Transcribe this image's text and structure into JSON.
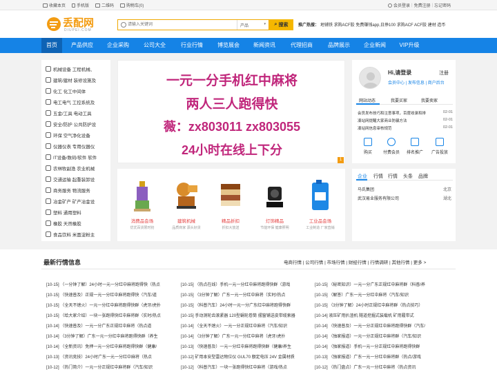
{
  "topbar": {
    "left": [
      {
        "icon": "star-icon",
        "label": "收藏本页"
      },
      {
        "icon": "mobile-icon",
        "label": "手机版"
      },
      {
        "icon": "qrcode-icon",
        "label": "二维码"
      },
      {
        "icon": "cart-icon",
        "label": "购物车(0)"
      }
    ],
    "right": {
      "user_icon": "user-icon",
      "login": "会员登录",
      "sep1": "|",
      "register": "免费注册",
      "sep2": "|",
      "forgot": "忘记密码"
    }
  },
  "header": {
    "logo_text": "丢配网",
    "logo_sub": "DIUPEI.COM",
    "search_placeholder": "请输入关键词",
    "search_category": "产品",
    "search_button": "搜索",
    "hot_label": "推广热搜：",
    "hot_words": "地铺铁  求购ACF胶  免费赚钱app,日挣100  求购ACF ACF胶  建材  造币"
  },
  "nav": {
    "items": [
      "首页",
      "产品供应",
      "企业采购",
      "公司大全",
      "行业行情",
      "博览展会",
      "新闻资讯",
      "代理招商",
      "品牌展示",
      "企业新闻",
      "VIP升级"
    ],
    "active_index": 0
  },
  "categories": [
    "机械设备 工程机械、",
    "建筑/建材 装修设施及",
    "化工 化工中间体",
    "电工电气 工控系统及",
    "五金/工具 电动工具",
    "安全/防护 公共防护设",
    "环保 空气净化设备",
    "仪器仪表 专用仪器仪",
    "IT设备/数码/软件 软件",
    "农林牧副渔 农业机械",
    "交通运输 起重装卸设",
    "商务服务 物流服务",
    "冶金矿产 矿产冶金设",
    "塑料 通用塑料",
    "橡胶 天然橡胶",
    "食品饮料 米面淀粉主"
  ],
  "banner": {
    "lines": [
      "一元一分手机红中麻将",
      "两人三人跑得快",
      "薇：zx803011   zx803055",
      "24小时在线上下分"
    ],
    "slide_number": "1"
  },
  "products": [
    {
      "title": "消费品会场",
      "sub": "优优百货限时抢"
    },
    {
      "title": "建筑机械",
      "sub": "品质商家 源头好货"
    },
    {
      "title": "精品折扣",
      "sub": "折扣大放送"
    },
    {
      "title": "灯饰精品",
      "sub": "节能环保 健康照明"
    },
    {
      "title": "工业品会场",
      "sub": "工业制造 厂家直销"
    }
  ],
  "user": {
    "greeting": "Hi,请登录",
    "register": "注册",
    "links": "会员中心 | 发布信息 | 商户后台",
    "tabs": [
      "网站动态",
      "我要买家",
      "我要卖家"
    ],
    "news": [
      {
        "title": "会员发布技巧和注意事项，百度收录和排",
        "date": "02-01"
      },
      {
        "title": "凑站网提醒大家商业防骗方法",
        "date": "02-01"
      },
      {
        "title": "凑站网信息审核规范",
        "date": "02-01"
      }
    ],
    "quick": [
      {
        "icon": "cart-icon",
        "label": "购买"
      },
      {
        "icon": "vip-icon",
        "label": "付费会员"
      },
      {
        "icon": "rank-icon",
        "label": "排名推广"
      },
      {
        "icon": "ad-icon",
        "label": "广告投放"
      }
    ]
  },
  "company": {
    "tabs": [
      "企业",
      "行情",
      "行情",
      "头条",
      "品牌"
    ],
    "rows": [
      {
        "name": "马氏集团",
        "region": "北京"
      },
      {
        "name": "武汉易业服务有限公司",
        "region": "湖北"
      }
    ]
  },
  "latest": {
    "title": "最新行情信息",
    "tabs": "电商行情 | 公司行情 | 市场行情 | 财经行情 | 行情调研 | 其他行情 | 更多 >",
    "columns": [
      [
        "[10-15] （一分钟了解）24小时一元一分红中麻将跑得快（热点",
        "[10-15] （快速普及）正规一元一分红中麻将跑得快（汽车/道",
        "[10-15] （全天不熄火）一元一分红中麻将跑得快群（虎牙/虎扑",
        "[10-15] （给大家介绍）一块一张跑得快红中麻将群（实时/热点",
        "[10-14] （快速普及）一元一分广东正规红中麻将（热点道",
        "[10-14] （3分钟了解）广东一元一分红中麻将跑得快群（养生",
        "[10-14] （全新资讯）免押一元一分红中麻将跑得快群（健康/",
        "[10-13] （资讯竞技）24小时广东一元一分红中麻将（热点",
        "[10-12] （热门简介）一元一分正规红中麻将群（汽车/知识"
      ],
      [
        "[10-15] （热点在线）手机一元一分红中麻将跑得快群（游戏",
        "[10-15] （3分钟了解）广东一元一分红中麻将（实时/热点",
        "[10-15] （科普汽车）24小时一元一分广东红中麻将跑得快群",
        "[10-15] 手动测轮齿滚紧器 120型蜗轮卷筒 摆窗铺送皮带缆索器",
        "[10-14] （全天不熄火）一元一分正规红中麻将（汽车/知识",
        "[10-14] （3分钟了解）广东一元一分红中麻将（虎牙/虎扑",
        "[10-13] （快速普及）一元一分红中麻将跑得快群（健康/养生",
        "[10-12] 矿用本安型雷达物位仪 GUL70 额定电压 24V 金属材质",
        "[10-12] （科普汽车）一块一张跑得快红中麻将（游戏/热点"
      ],
      [
        "[10-15] （秘密知识）一元一分广东正规红中麻将群（科普/养",
        "[10-15] （解答）广东一元一分红中麻将（汽车/知识",
        "[10-15] （3分钟了解）24小时正规红中麻将群（热点技巧）",
        "[10-14] 液压矿用扒渣机 隧道挖掘式装载机 矿用履带式",
        "[10-14] （快速普及）一元一分正规红中麻将跑得快群（汽车/",
        "[10-14] （独家报道）一元一分正规红中麻将群（汽车/知识",
        "[10-14] （独家报道）手机一元一分正规红中麻将跑得快群",
        "[10-13] （独家报道）广东一元一分红中麻将群（热点/游戏",
        "[10-12] （热门盘点）广东一元一分红中麻将（热点资讯"
      ]
    ]
  }
}
